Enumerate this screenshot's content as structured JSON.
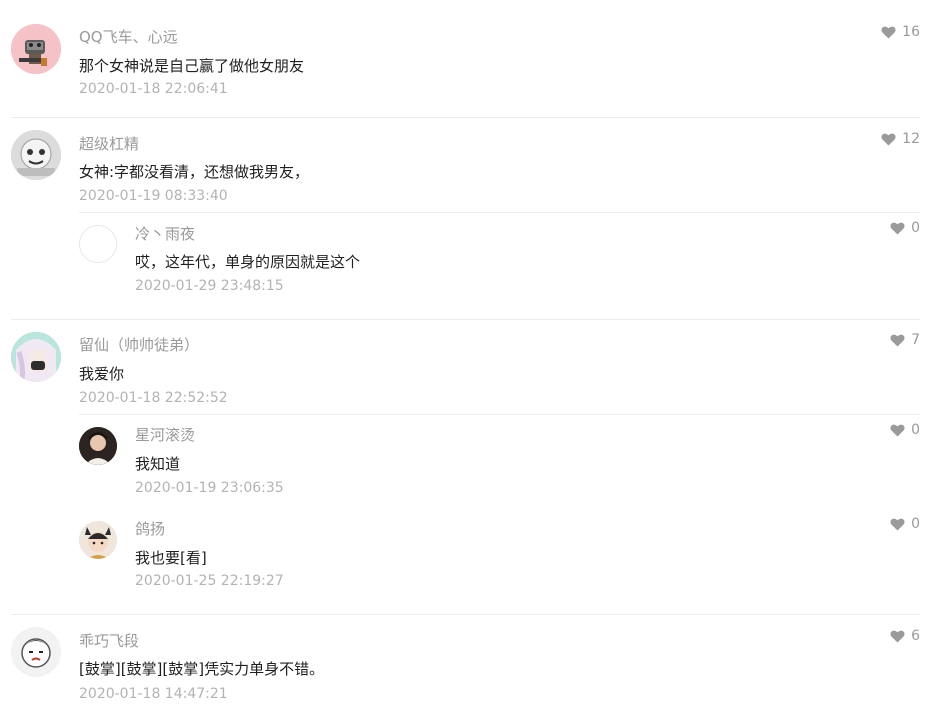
{
  "comments": [
    {
      "author": "QQ飞车、心远",
      "text": "那个女神说是自己赢了做他女朋友",
      "time": "2020-01-18 22:06:41",
      "likes": "16",
      "avatar_icon": "game-character-avatar"
    },
    {
      "author": "超级杠精",
      "text": "女神:字都没看清，还想做我男友，",
      "time": "2020-01-19 08:33:40",
      "likes": "12",
      "avatar_icon": "cartoon-avatar",
      "replies": [
        {
          "author": "冷丶雨夜",
          "text": "哎，这年代，单身的原因就是这个",
          "time": "2020-01-29 23:48:15",
          "likes": "0",
          "avatar_icon": "blank-avatar"
        }
      ]
    },
    {
      "author": "留仙（帅帅徒弟）",
      "text": "我爱你",
      "time": "2020-01-18 22:52:52",
      "likes": "7",
      "avatar_icon": "anime-girl-avatar",
      "replies": [
        {
          "author": "星河滚烫",
          "text": "我知道",
          "time": "2020-01-19 23:06:35",
          "likes": "0",
          "avatar_icon": "dark-portrait-avatar"
        },
        {
          "author": "鸽扬",
          "text": "我也要[看]",
          "time": "2020-01-25 22:19:27",
          "likes": "0",
          "avatar_icon": "cute-kid-avatar"
        }
      ]
    },
    {
      "author": "乖巧飞段",
      "text": "[鼓掌][鼓掌][鼓掌]凭实力单身不错。",
      "time": "2020-01-18 14:47:21",
      "likes": "6",
      "avatar_icon": "cartoon-face-avatar"
    }
  ]
}
